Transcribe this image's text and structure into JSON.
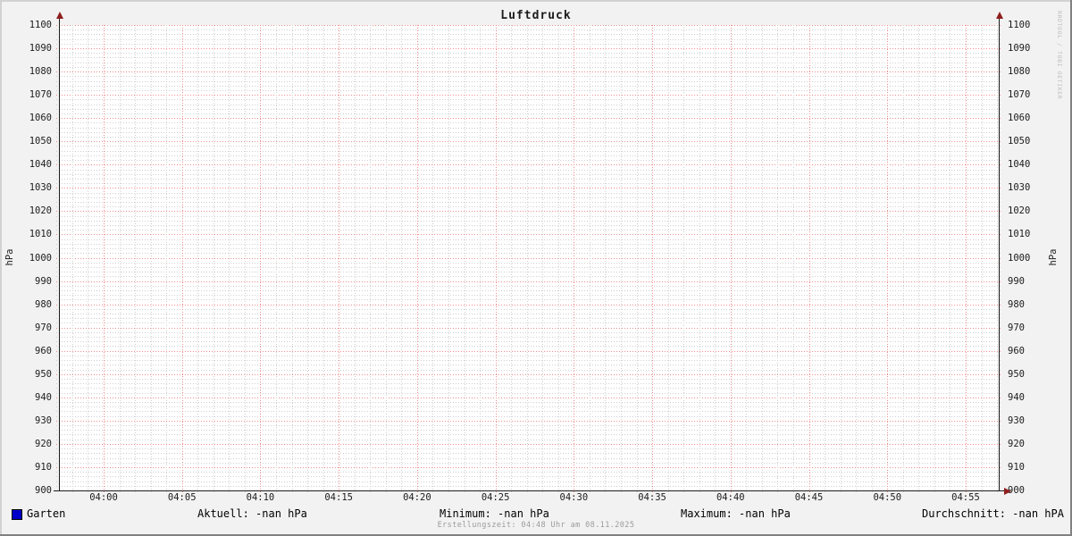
{
  "title": "Luftdruck",
  "watermark": "RRDTOOL / TOBI OETIKER",
  "y_axis": {
    "unit_left": "hPa",
    "unit_right": "hPa",
    "min": 900,
    "max": 1100,
    "major_step": 10,
    "minor_step": 2,
    "tick_labels": [
      "900",
      "910",
      "920",
      "930",
      "940",
      "950",
      "960",
      "970",
      "980",
      "990",
      "1000",
      "1010",
      "1020",
      "1030",
      "1040",
      "1050",
      "1060",
      "1070",
      "1080",
      "1090",
      "1100"
    ]
  },
  "x_axis": {
    "tick_labels": [
      "04:00",
      "04:05",
      "04:10",
      "04:15",
      "04:20",
      "04:25",
      "04:30",
      "04:35",
      "04:40",
      "04:45",
      "04:50",
      "04:55"
    ],
    "major_step_minutes": 5,
    "minor_step_minutes": 1,
    "minutes_before_first_label": 2,
    "minutes_after_last_label": 2
  },
  "legend": {
    "series_label": "Garten",
    "swatch_color": "#0000c8",
    "stats": [
      {
        "label": "Aktuell",
        "value": "-nan hPa",
        "text": "Aktuell: -nan hPa"
      },
      {
        "label": "Minimum",
        "value": "-nan hPa",
        "text": "Minimum: -nan hPa"
      },
      {
        "label": "Maximum",
        "value": "-nan hPa",
        "text": "Maximum: -nan hPa"
      },
      {
        "label": "Durchschnitt",
        "value": "-nan hPA",
        "text": "Durchschnitt: -nan hPA"
      }
    ]
  },
  "footer": "Erstellungszeit: 04:48 Uhr am 08.11.2025",
  "colors": {
    "background": "#f2f2f2",
    "canvas": "#ffffff",
    "major_grid": "#f08c8c",
    "minor_grid": "#cfcfcf",
    "axis": "#1c1c1c",
    "axis_arrow": "#8f1d1d",
    "series_swatch": "#0000c8",
    "footer_text": "#9b9b9b",
    "watermark_text": "#bcbcbc"
  },
  "chart_data": {
    "type": "line",
    "title": "Luftdruck",
    "xlabel": "",
    "ylabel": "hPa",
    "ylim": [
      900,
      1100
    ],
    "y_major_step": 10,
    "y_minor_step": 2,
    "x_ticks": [
      "04:00",
      "04:05",
      "04:10",
      "04:15",
      "04:20",
      "04:25",
      "04:30",
      "04:35",
      "04:40",
      "04:45",
      "04:50",
      "04:55"
    ],
    "grid": "on",
    "legend_position": "bottom",
    "series": [
      {
        "name": "Garten",
        "color": "#0000c8",
        "values": [],
        "note": "no data points drawn; all values are -nan"
      }
    ],
    "stats": {
      "aktuell": "-nan hPa",
      "minimum": "-nan hPa",
      "maximum": "-nan hPa",
      "durchschnitt": "-nan hPA"
    },
    "generated_at": "Erstellungszeit: 04:48 Uhr am 08.11.2025"
  }
}
